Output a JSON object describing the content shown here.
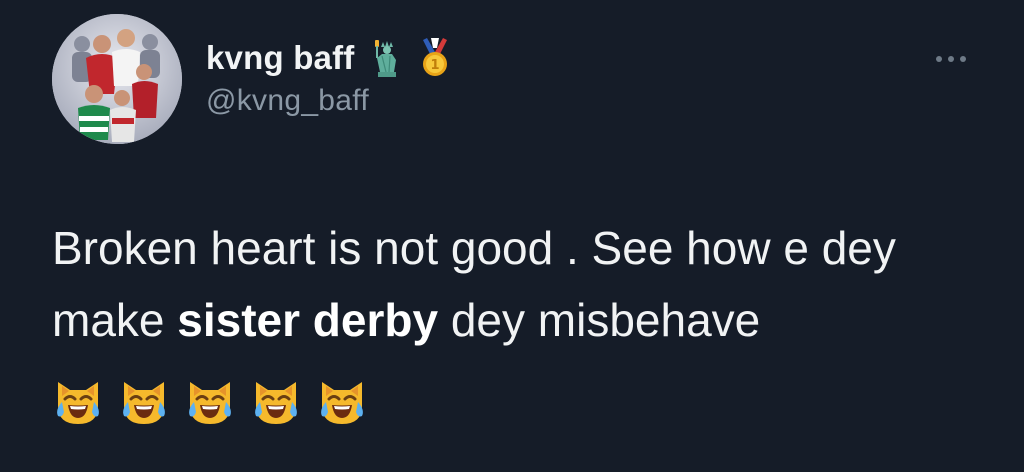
{
  "user": {
    "display_name": "kvng baff",
    "handle": "@kvng_baff",
    "badges": [
      "statue-of-liberty-emoji",
      "first-place-medal-emoji"
    ]
  },
  "tweet": {
    "text_part1": "Broken heart is not good . See how e dey make ",
    "text_bold": "sister derby",
    "text_part2": " dey misbehave",
    "emojis": [
      "cat-tears-of-joy-emoji",
      "cat-tears-of-joy-emoji",
      "cat-tears-of-joy-emoji",
      "cat-tears-of-joy-emoji",
      "cat-tears-of-joy-emoji"
    ]
  },
  "colors": {
    "background": "#151c28",
    "primary_text": "#f1f3f4",
    "secondary_text": "#8b98a5"
  }
}
